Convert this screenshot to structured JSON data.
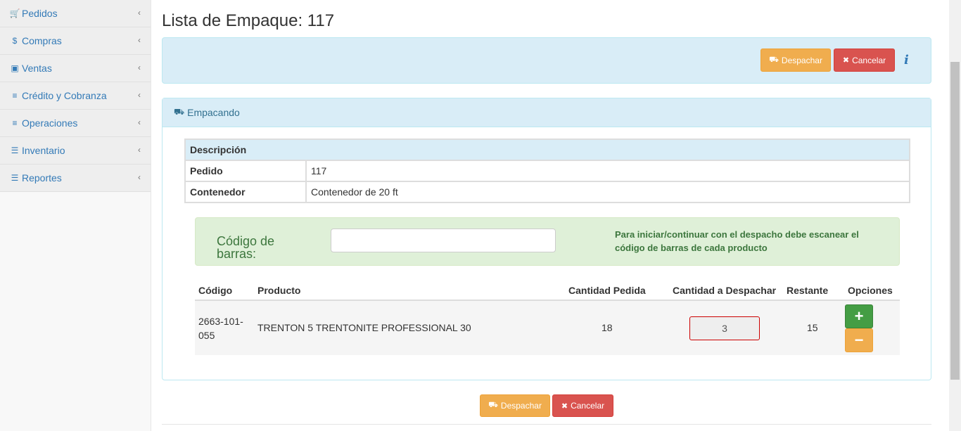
{
  "sidebar": {
    "items": [
      {
        "label": "Pedidos",
        "icon": "shopping-cart-icon",
        "glyph": "🛒"
      },
      {
        "label": "Compras",
        "icon": "dollar-icon",
        "glyph": "$"
      },
      {
        "label": "Ventas",
        "icon": "money-icon",
        "glyph": "▣"
      },
      {
        "label": "Crédito y Cobranza",
        "icon": "sliders-icon",
        "glyph": "≡"
      },
      {
        "label": "Operaciones",
        "icon": "sliders-icon",
        "glyph": "≡"
      },
      {
        "label": "Inventario",
        "icon": "list-icon",
        "glyph": "☰"
      },
      {
        "label": "Reportes",
        "icon": "list-icon",
        "glyph": "☰"
      }
    ],
    "chevron": "‹"
  },
  "page": {
    "title": "Lista de Empaque: 117"
  },
  "toolbar": {
    "despachar_label": "Despachar",
    "cancelar_label": "Cancelar",
    "truck_glyph": "⛟",
    "x_glyph": "✖",
    "info_glyph": "i"
  },
  "panel": {
    "heading": "Empacando",
    "truck_glyph": "⛟"
  },
  "description": {
    "header": "Descripción",
    "rows": [
      {
        "key": "Pedido",
        "value": "117"
      },
      {
        "key": "Contenedor",
        "value": "Contenedor de 20 ft"
      }
    ]
  },
  "barcode": {
    "label": "Código de barras:",
    "value": "",
    "help": "Para iniciar/continuar con el despacho debe escanear el código de barras de cada producto"
  },
  "products": {
    "columns": [
      "Código",
      "Producto",
      "Cantidad Pedida",
      "Cantidad a Despachar",
      "Restante",
      "Opciones"
    ],
    "rows": [
      {
        "codigo": "2663-101-055",
        "producto": "TRENTON 5 TRENTONITE PROFESSIONAL 30",
        "pedida": "18",
        "despachar": "3",
        "restante": "15"
      }
    ],
    "plus_glyph": "+",
    "minus_glyph": "−"
  },
  "colors": {
    "warning": "#f0ad4e",
    "danger": "#d9534f",
    "success": "#449d44",
    "info_bg": "#d9edf7",
    "success_bg": "#dff0d8"
  }
}
